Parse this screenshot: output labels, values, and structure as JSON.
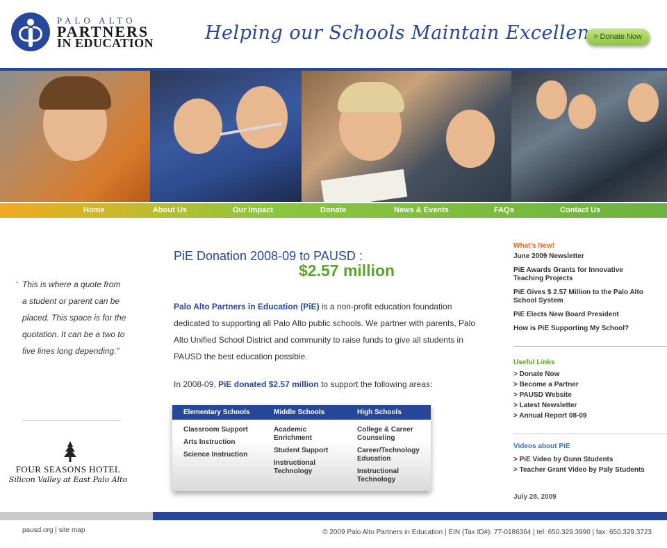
{
  "colors": {
    "brand_blue": "#27479a",
    "brand_green": "#59a52c",
    "whats_new_orange": "#e0651f",
    "useful_links_green": "#59a52c",
    "videos_blue": "#3a6fb0"
  },
  "header": {
    "logo_small": "PALO ALTO",
    "logo_line1": "PARTNERS",
    "logo_line2": "IN EDUCATION",
    "tagline": "Helping our Schools Maintain Excellence",
    "donate_button": "> Donate Now"
  },
  "nav": {
    "items": [
      {
        "label": "Home"
      },
      {
        "label": "About Us"
      },
      {
        "label": "Our Impact"
      },
      {
        "label": "Donate"
      },
      {
        "label": "News & Events"
      },
      {
        "label": "FAQs"
      },
      {
        "label": "Contact Us"
      }
    ]
  },
  "left": {
    "quote_open": "“",
    "quote_text": "This is where a quote from a student or parent can be placed. This space is for the quotation. It can be a two to five lines long depending.”",
    "sponsor_name": "FOUR SEASONS HOTEL",
    "sponsor_sub": "Silicon Valley at East Palo Alto"
  },
  "main": {
    "title": "PiE Donation 2008-09 to PAUSD :",
    "amount": "$2.57 million",
    "intro_brand": "Palo Alto Partners in Education (PiE)",
    "intro_rest": " is a non-profit education foundation dedicated to supporting all Palo Alto public schools. We partner with parents, Palo Alto Unified School District and community to raise funds to give all students in PAUSD the best education possible.",
    "donated_pre": "In 2008-09, ",
    "donated_brand": "PiE donated $2.57 million",
    "donated_post": " to support the following areas:"
  },
  "areas_table": {
    "headers": [
      "Elementary Schools",
      "Middle Schools",
      "High Schools"
    ],
    "elementary": [
      "Classroom Support",
      "Arts Instruction",
      "Science Instruction"
    ],
    "middle": [
      "Academic Enrichment",
      "Student Support",
      "Instructional Technology"
    ],
    "high": [
      "College & Career Counseling",
      "Career/Technology Education",
      "Instructional Technology"
    ]
  },
  "sidebar": {
    "whats_new_heading": "What's New!",
    "news": [
      "June 2009 Newsletter",
      "PiE Awards Grants for Innovative Teaching Projects",
      "PiE Gives $ 2.57 Million to the Palo Alto School System",
      "PiE Elects New Board President",
      "How is PiE Supporting My School?"
    ],
    "useful_links_heading": "Useful Links",
    "links": [
      "> Donate Now",
      "> Become a Partner",
      "> PAUSD Website",
      "> Latest Newsletter",
      "> Annual Report 08-09"
    ],
    "videos_heading": "Videos about PiE",
    "videos": [
      "> PiE Video by Gunn Students",
      "> Teacher Grant Video by Paly Students"
    ],
    "date": "July 28, 2009"
  },
  "footer": {
    "link_pausd": "pausd.org",
    "separator": " | ",
    "link_sitemap": "site map",
    "copyright": "© 2009 Palo Alto Partners in Education | EIN (Tax ID#): 77-0186364 | tel: 650.329.3990 | fax: 650.329.3723"
  }
}
